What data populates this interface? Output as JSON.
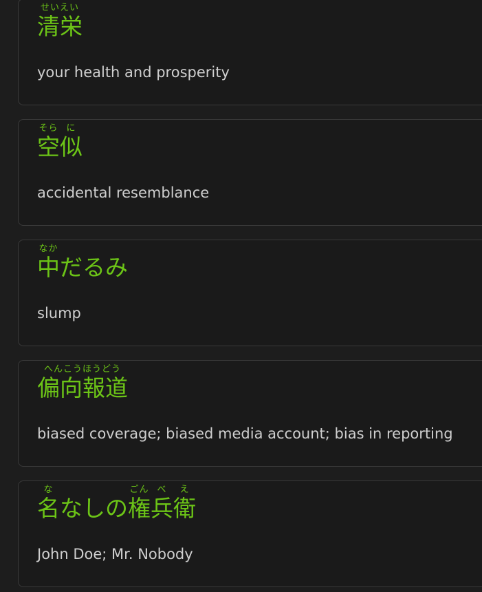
{
  "entries": [
    {
      "segments": [
        {
          "text": "清栄",
          "reading": "せいえい"
        }
      ],
      "meaning": "your health and prosperity"
    },
    {
      "segments": [
        {
          "text": "空",
          "reading": "そら"
        },
        {
          "text": "似",
          "reading": "に"
        }
      ],
      "meaning": "accidental resemblance"
    },
    {
      "segments": [
        {
          "text": "中",
          "reading": "なか"
        },
        {
          "text": "だるみ",
          "reading": ""
        }
      ],
      "meaning": "slump"
    },
    {
      "segments": [
        {
          "text": "偏向報道",
          "reading": "へんこうほうどう"
        }
      ],
      "meaning": "biased coverage; biased media account; bias in reporting"
    },
    {
      "segments": [
        {
          "text": "名",
          "reading": "な"
        },
        {
          "text": "なしの",
          "reading": ""
        },
        {
          "text": "権",
          "reading": "ごん"
        },
        {
          "text": "兵",
          "reading": "べ"
        },
        {
          "text": "衛",
          "reading": "え"
        }
      ],
      "meaning": "John Doe; Mr. Nobody"
    }
  ],
  "colors": {
    "background": "#1d1d1d",
    "card_background": "#1a1a1a",
    "card_border": "#3a3a3a",
    "word_color": "#6cc417",
    "meaning_color": "#cfcfcf"
  }
}
